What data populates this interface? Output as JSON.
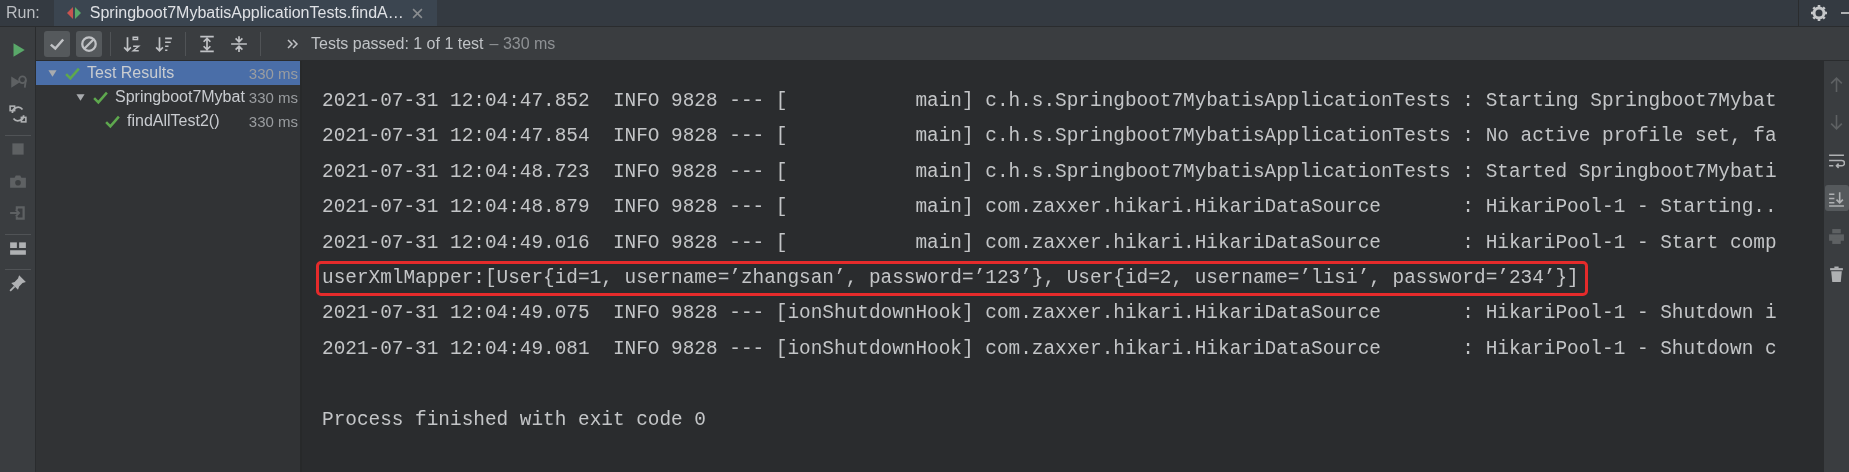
{
  "run_tab_bar": {
    "label": "Run:",
    "tab": {
      "title": "Springboot7MybatisApplicationTests.findA…",
      "selected": true
    }
  },
  "side_toolbar": {
    "groups": [
      [
        {
          "kind": "run",
          "disabled": false
        },
        {
          "kind": "rerun-failed",
          "disabled": true
        },
        {
          "kind": "auto-test",
          "disabled": false
        }
      ],
      [
        {
          "kind": "stop",
          "disabled": true
        },
        {
          "kind": "snapshot",
          "disabled": true
        },
        {
          "kind": "import",
          "disabled": true
        }
      ],
      [
        {
          "kind": "layout",
          "disabled": false
        }
      ],
      [
        {
          "kind": "pin",
          "disabled": false
        }
      ]
    ]
  },
  "test_toolbar": {
    "groups": [
      [
        {
          "kind": "show-passed",
          "on": true
        },
        {
          "kind": "show-ignored",
          "on": true
        }
      ],
      [
        {
          "kind": "sort-alpha",
          "on": false
        },
        {
          "kind": "sort-duration",
          "on": false
        }
      ],
      [
        {
          "kind": "expand-all",
          "on": false
        },
        {
          "kind": "collapse-all",
          "on": false
        }
      ]
    ],
    "status": "Tests passed: 1 of 1 test",
    "duration": "– 330 ms"
  },
  "test_tree": [
    {
      "label": "Test Results",
      "duration": "330 ms",
      "passed": true,
      "expanded": true,
      "selected": true,
      "children": [
        {
          "label": "Springboot7Mybat",
          "duration": "330 ms",
          "passed": true,
          "expanded": true,
          "selected": false,
          "children": [
            {
              "label": "findAllTest2()",
              "duration": "330 ms",
              "passed": true,
              "selected": false
            }
          ]
        }
      ]
    }
  ],
  "console": {
    "lines": [
      {
        "text": "2021-07-31 12:04:47.852  INFO 9828 --- [           main] c.h.s.Springboot7MybatisApplicationTests : Starting Springboot7Mybat",
        "highlighted": false
      },
      {
        "text": "2021-07-31 12:04:47.854  INFO 9828 --- [           main] c.h.s.Springboot7MybatisApplicationTests : No active profile set, fa",
        "highlighted": false
      },
      {
        "text": "2021-07-31 12:04:48.723  INFO 9828 --- [           main] c.h.s.Springboot7MybatisApplicationTests : Started Springboot7Mybati",
        "highlighted": false
      },
      {
        "text": "2021-07-31 12:04:48.879  INFO 9828 --- [           main] com.zaxxer.hikari.HikariDataSource       : HikariPool-1 - Starting..",
        "highlighted": false
      },
      {
        "text": "2021-07-31 12:04:49.016  INFO 9828 --- [           main] com.zaxxer.hikari.HikariDataSource       : HikariPool-1 - Start comp",
        "highlighted": false
      },
      {
        "text": "userXmlMapper:[User{id=1, username=’zhangsan’, password=’123’}, User{id=2, username=’lisi’, password=’234’}]",
        "highlighted": true
      },
      {
        "text": "2021-07-31 12:04:49.075  INFO 9828 --- [ionShutdownHook] com.zaxxer.hikari.HikariDataSource       : HikariPool-1 - Shutdown i",
        "highlighted": false
      },
      {
        "text": "2021-07-31 12:04:49.081  INFO 9828 --- [ionShutdownHook] com.zaxxer.hikari.HikariDataSource       : HikariPool-1 - Shutdown c",
        "highlighted": false
      }
    ],
    "exit_message": "Process finished with exit code 0"
  },
  "console_toolbar": [
    {
      "kind": "up",
      "disabled": true,
      "on": false
    },
    {
      "kind": "down",
      "disabled": true,
      "on": false
    },
    {
      "kind": "soft-wrap",
      "disabled": false,
      "on": false
    },
    {
      "kind": "scroll-to-end",
      "disabled": false,
      "on": true
    },
    {
      "kind": "print",
      "disabled": true,
      "on": false
    },
    {
      "kind": "trash",
      "disabled": false,
      "on": false
    }
  ]
}
